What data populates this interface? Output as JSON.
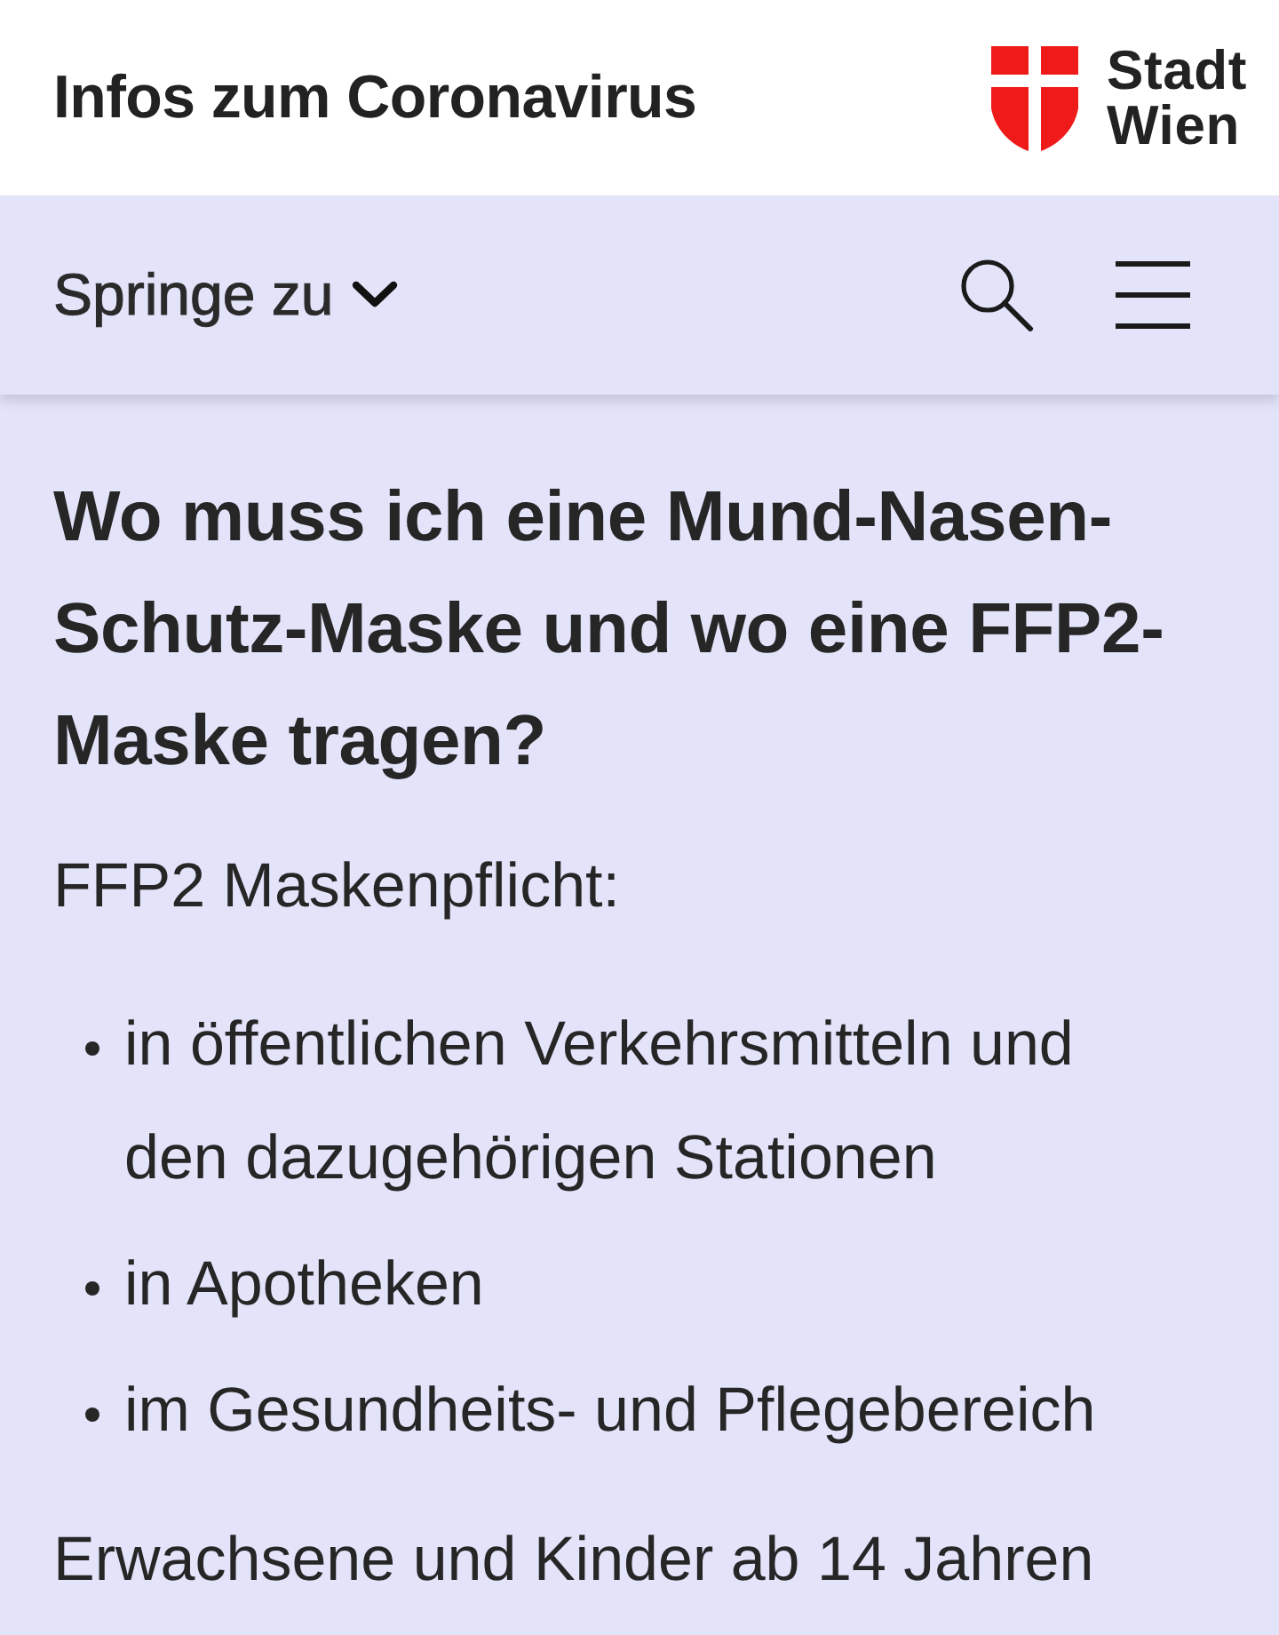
{
  "header": {
    "title": "Infos zum Coronavirus",
    "logo_text": "Stadt Wien"
  },
  "nav": {
    "jump_label": "Springe zu"
  },
  "content": {
    "heading": "Wo muss ich eine Mund-Nasen-Schutz-Maske und wo eine FFP2-Maske tragen?",
    "intro": "FFP2 Maskenpflicht:",
    "items": [
      "in öffentlichen Verkehrsmitteln und den dazugehörigen Stationen",
      "in Apotheken",
      "im Gesundheits- und Pflegebereich"
    ],
    "paragraph": "Erwachsene und Kinder ab 14 Jahren"
  }
}
